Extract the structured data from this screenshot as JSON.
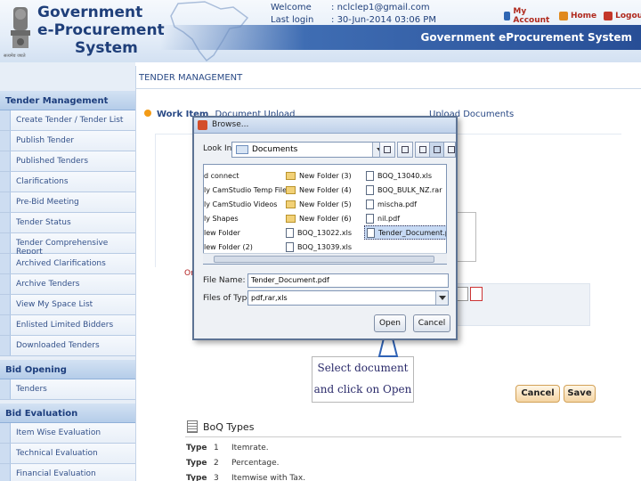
{
  "header": {
    "brand_line1": "Government",
    "brand_line2": "e-Procurement",
    "brand_line3": "System",
    "emblem_text": "सत्यमेव जयते",
    "welcome_label": "Welcome",
    "welcome_value": "nclclep1@gmail.com",
    "lastlogin_label": "Last login",
    "lastlogin_value": "30-Jun-2014 03:06 PM",
    "my_account": "My Account",
    "home": "Home",
    "logout": "Logout",
    "subtitle": "Government eProcurement System"
  },
  "main": {
    "section_title": "TENDER MANAGEMENT",
    "crumb_bold": "Work Item",
    "crumb_rest": "Document Upload",
    "crumb_tail": "Upload Documents",
    "error_fragment": "On",
    "callout_line1": "Select document",
    "callout_line2": "and click on Open",
    "cancel_label": "Cancel",
    "save_label": "Save"
  },
  "sidebar": {
    "section1": "Tender Management",
    "items1": [
      "Create Tender / Tender List",
      "Publish Tender",
      "Published Tenders",
      "Clarifications",
      "Pre-Bid Meeting",
      "Tender Status",
      "Tender Comprehensive Report",
      "Archived Clarifications",
      "Archive Tenders",
      "View My Space List",
      "Enlisted Limited Bidders",
      "Downloaded Tenders"
    ],
    "section2": "Bid Opening",
    "items2": [
      "Tenders"
    ],
    "section3": "Bid Evaluation",
    "items3": [
      "Item Wise Evaluation",
      "Technical Evaluation",
      "Financial Evaluation"
    ]
  },
  "boq": {
    "title": "BoQ Types",
    "rows": [
      {
        "type": "Type",
        "num": "1",
        "desc": "Itemrate."
      },
      {
        "type": "Type",
        "num": "2",
        "desc": "Percentage."
      },
      {
        "type": "Type",
        "num": "3",
        "desc": "Itemwise with Tax."
      }
    ]
  },
  "dialog": {
    "title": "Browse...",
    "lookin_label": "Look In:",
    "lookin_value": "Documents",
    "col1": [
      "d connect",
      "ly CamStudio Temp Files",
      "ly CamStudio Videos",
      "ly Shapes",
      "lew Folder",
      "lew Folder (2)"
    ],
    "col2": [
      "New Folder (3)",
      "New Folder (4)",
      "New Folder (5)",
      "New Folder (6)",
      "BOQ_13022.xls",
      "BOQ_13039.xls"
    ],
    "col3": [
      "BOQ_13040.xls",
      "BOQ_BULK_NZ.rar",
      "mischa.pdf",
      "nil.pdf",
      "Tender_Document.pdf"
    ],
    "selected": "Tender_Document.pdf",
    "filename_label": "File Name:",
    "filename_value": "Tender_Document.pdf",
    "filetype_label": "Files of Type:",
    "filetype_value": "pdf,rar,xls",
    "open_label": "Open",
    "cancel_label": "Cancel"
  },
  "colors": {
    "brand_blue": "#1f3f7a",
    "header_band": "#274e96",
    "link_red": "#b02a1e",
    "accent_orange": "#f39b16"
  }
}
